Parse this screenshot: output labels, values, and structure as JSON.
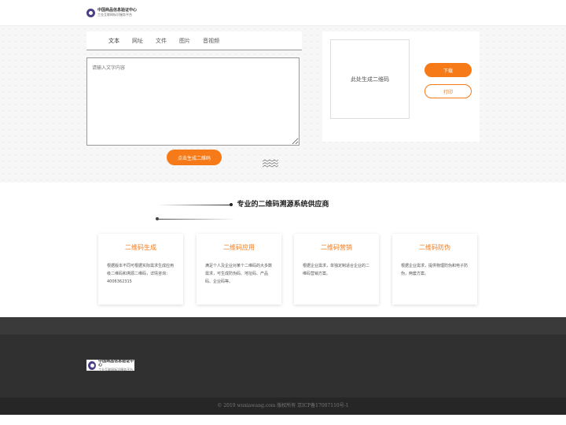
{
  "header": {
    "logo_line1": "中国商品信息验证中心",
    "logo_line2": "工业互联网标识服务平台"
  },
  "tool": {
    "tabs": [
      {
        "label": "文本"
      },
      {
        "label": "网址"
      },
      {
        "label": "文件"
      },
      {
        "label": "图片"
      },
      {
        "label": "音视频"
      }
    ],
    "input_placeholder": "请输入文字内容",
    "generate_label": "点击生成二维码"
  },
  "qr": {
    "placeholder_text": "此处生成二维码",
    "download_label": "下载",
    "print_label": "打印"
  },
  "section": {
    "title": "专业的二维码溯源系统供应商",
    "cards": [
      {
        "title": "二维码生成",
        "desc": "根据版本不同可根据实际需求生成应用级二维码和溯源二维码，详情咨询：4006362315"
      },
      {
        "title": "二维码应用",
        "desc": "满足个人及企业对某个二维码的大多数需求，可生成防伪码、地址码、产品码、企业码等。"
      },
      {
        "title": "二维码营销",
        "desc": "根据企业需求，单独定制适合企业的二维码营销方案。"
      },
      {
        "title": "二维码防伪",
        "desc": "根据企业需求，提供物理防伪和电子防伪，两套方案。"
      }
    ]
  },
  "footer": {
    "logo_line1": "中国商品信息验证中心",
    "logo_line2": "工业互联网标识服务平台",
    "copyright": "© 2019 wuxiawang.com 版权所有 京ICP备17007110号-1"
  },
  "colors": {
    "accent": "#f67a17",
    "footer_bg": "#303030",
    "logo_purple": "#4b3f86"
  }
}
